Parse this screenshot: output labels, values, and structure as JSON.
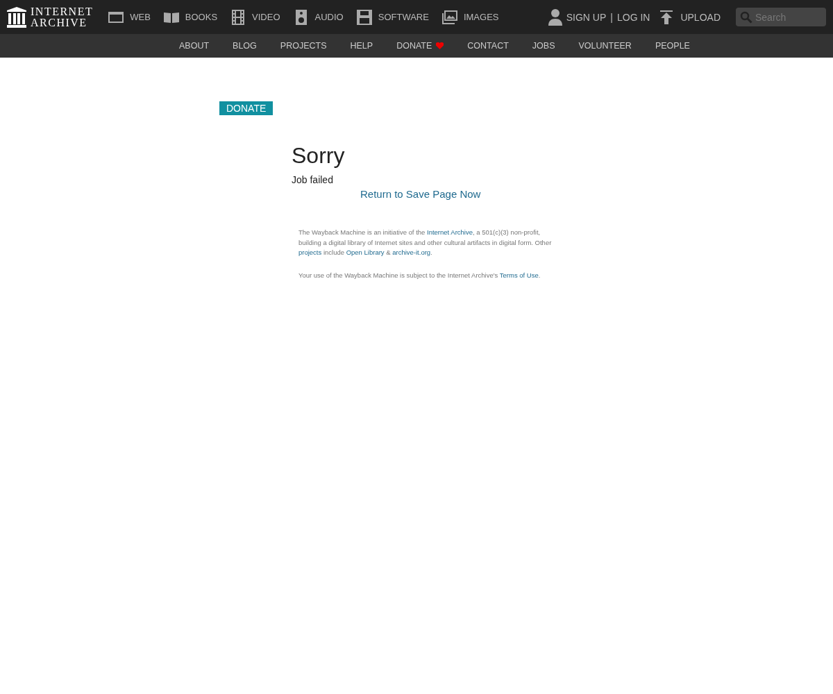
{
  "logo": {
    "lines": [
      "INTERNET",
      "ARCHIVE"
    ]
  },
  "media": [
    {
      "label": "WEB",
      "kind": "web"
    },
    {
      "label": "BOOKS",
      "kind": "books"
    },
    {
      "label": "VIDEO",
      "kind": "video"
    },
    {
      "label": "AUDIO",
      "kind": "audio"
    },
    {
      "label": "SOFTWARE",
      "kind": "software"
    },
    {
      "label": "IMAGES",
      "kind": "images"
    }
  ],
  "account": {
    "signup": "SIGN UP",
    "separator": "|",
    "login": "LOG IN"
  },
  "upload": "UPLOAD",
  "search": {
    "placeholder": "Search"
  },
  "subnav": [
    {
      "label": "ABOUT",
      "heart": false
    },
    {
      "label": "BLOG",
      "heart": false
    },
    {
      "label": "PROJECTS",
      "heart": false
    },
    {
      "label": "HELP",
      "heart": false
    },
    {
      "label": "DONATE",
      "heart": true
    },
    {
      "label": "CONTACT",
      "heart": false
    },
    {
      "label": "JOBS",
      "heart": false
    },
    {
      "label": "VOLUNTEER",
      "heart": false
    },
    {
      "label": "PEOPLE",
      "heart": false
    }
  ],
  "donate_button": "DONATE",
  "title": "Sorry",
  "message": "Job failed",
  "return_link": "Return to Save Page Now",
  "footer": [
    [
      {
        "kind": "text",
        "text": "The Wayback Machine is an initiative of the "
      },
      {
        "kind": "link",
        "text": "Internet Archive"
      },
      {
        "kind": "text",
        "text": ", a 501(c)(3) non-profit, building a digital library of Internet sites and other cultural artifacts in digital form. Other "
      },
      {
        "kind": "link",
        "text": "projects"
      },
      {
        "kind": "text",
        "text": " include "
      },
      {
        "kind": "link",
        "text": "Open Library"
      },
      {
        "kind": "text",
        "text": " & "
      },
      {
        "kind": "link",
        "text": "archive-it.org"
      },
      {
        "kind": "text",
        "text": "."
      }
    ],
    [
      {
        "kind": "text",
        "text": "Your use of the Wayback Machine is subject to the Internet Archive's "
      },
      {
        "kind": "link",
        "text": "Terms of Use"
      },
      {
        "kind": "text",
        "text": "."
      }
    ]
  ]
}
